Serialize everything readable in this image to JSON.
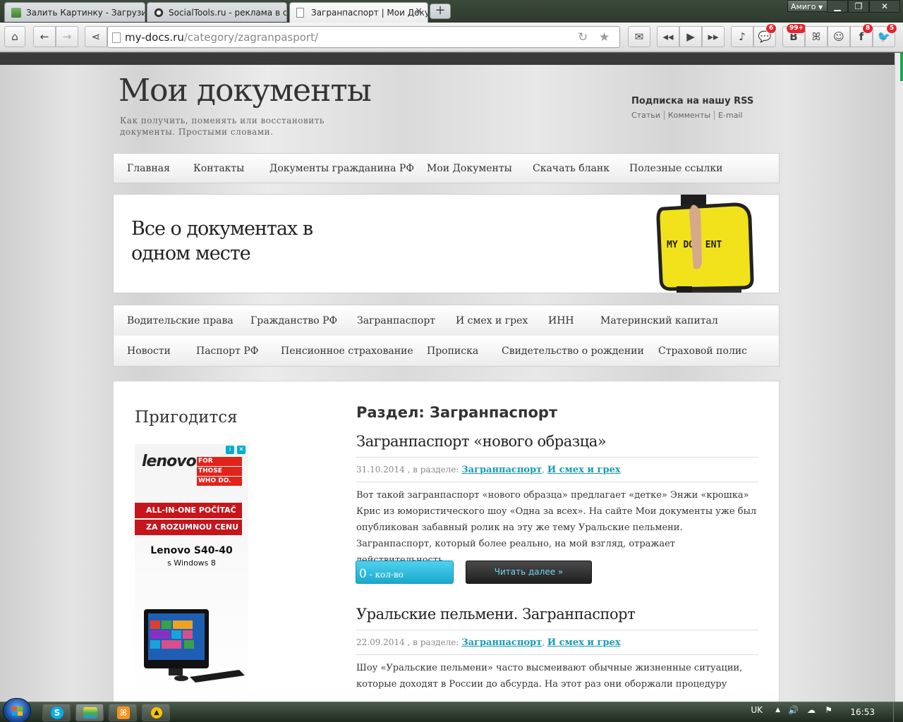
{
  "browser": {
    "tabs": [
      {
        "title": "Залить Картинку - Загрузить"
      },
      {
        "title": "SocialTools.ru - реклама в с"
      },
      {
        "title": "Загранпаспорт | Мои Доку"
      }
    ],
    "new_tab": "+",
    "amigo_label": "Амиго",
    "url_host": "my-docs.ru",
    "url_path": "/category/zagranpasport/",
    "badges": {
      "chat": "6",
      "vk": "99+",
      "facebook": "8",
      "twitter": "5"
    },
    "toolbar_icons": [
      "home-icon",
      "back-icon",
      "forward-icon",
      "share-icon",
      "mail-icon",
      "rewind-icon",
      "play-icon",
      "fast-forward-icon",
      "music-icon",
      "chat-icon",
      "vk-icon",
      "odnoklassniki-icon",
      "friends-icon",
      "facebook-icon",
      "twitter-icon"
    ]
  },
  "site": {
    "title": "Мои документы",
    "tagline": "Как получить, поменять или восстановить документы. Простыми словами.",
    "rss": {
      "heading": "Подписка на нашу RSS",
      "links": [
        "Статьи",
        "Комменты",
        "E-mail"
      ]
    },
    "main_nav": [
      "Главная",
      "Контакты",
      "Документы гражданина РФ",
      "Мои Документы",
      "Скачать бланк",
      "Полезные ссылки"
    ],
    "banner": {
      "line1": "Все о документах в",
      "line2": "одном месте",
      "bag_text": "MY DOC   ENT"
    },
    "category_nav": {
      "row1": [
        "Водительские права",
        "Гражданство РФ",
        "Загранпаспорт",
        "И смех и грех",
        "ИНН",
        "Материнский капитал"
      ],
      "row2": [
        "Новости",
        "Паспорт РФ",
        "Пенсионное страхование",
        "Прописка",
        "Свидетельство о рождении",
        "Страховой полис"
      ]
    }
  },
  "sidebar": {
    "title": "Пригодится",
    "ad": {
      "logo": "lenovo",
      "slogan": [
        "FOR",
        "THOSE",
        "WHO DO."
      ],
      "line1": "ALL-IN-ONE POČÍTAČ",
      "line2": "ZA ROZUMNOU CENU",
      "model": "Lenovo S40-40",
      "os": "s Windows 8"
    }
  },
  "content": {
    "section_title": "Раздел: Загранпаспорт",
    "posts": [
      {
        "title": "Загранпаспорт «нового образца»",
        "date": "31.10.2014",
        "meta_sep": " , в разделе: ",
        "categories": [
          "Загранпаспорт",
          "И смех и грех"
        ],
        "excerpt": "Вот такой загранпаспорт «нового образца» предлагает «детке» Энжи «крошка» Крис из юмористического шоу «Одна за всех». На сайте Мои документы уже был опубликован забавный ролик на эту же тему Уральские пельмени. Загранпаспорт, который более реально, на мой взгляд, отражает действительность.",
        "comments_count": "0",
        "comments_label": " - кол-во комментов",
        "read_more": "Читать далее »"
      },
      {
        "title": "Уральские пельмени. Загранпаспорт",
        "date": "22.09.2014",
        "meta_sep": " , в разделе: ",
        "categories": [
          "Загранпаспорт",
          "И смех и грех"
        ],
        "excerpt": "Шоу «Уральские пельмени» часто высмеивают обычные жизненные ситуации, которые доходят в России до абсурда. На этот раз они оборжали процедуру"
      }
    ]
  },
  "taskbar": {
    "language": "UK",
    "time": "16:53"
  }
}
